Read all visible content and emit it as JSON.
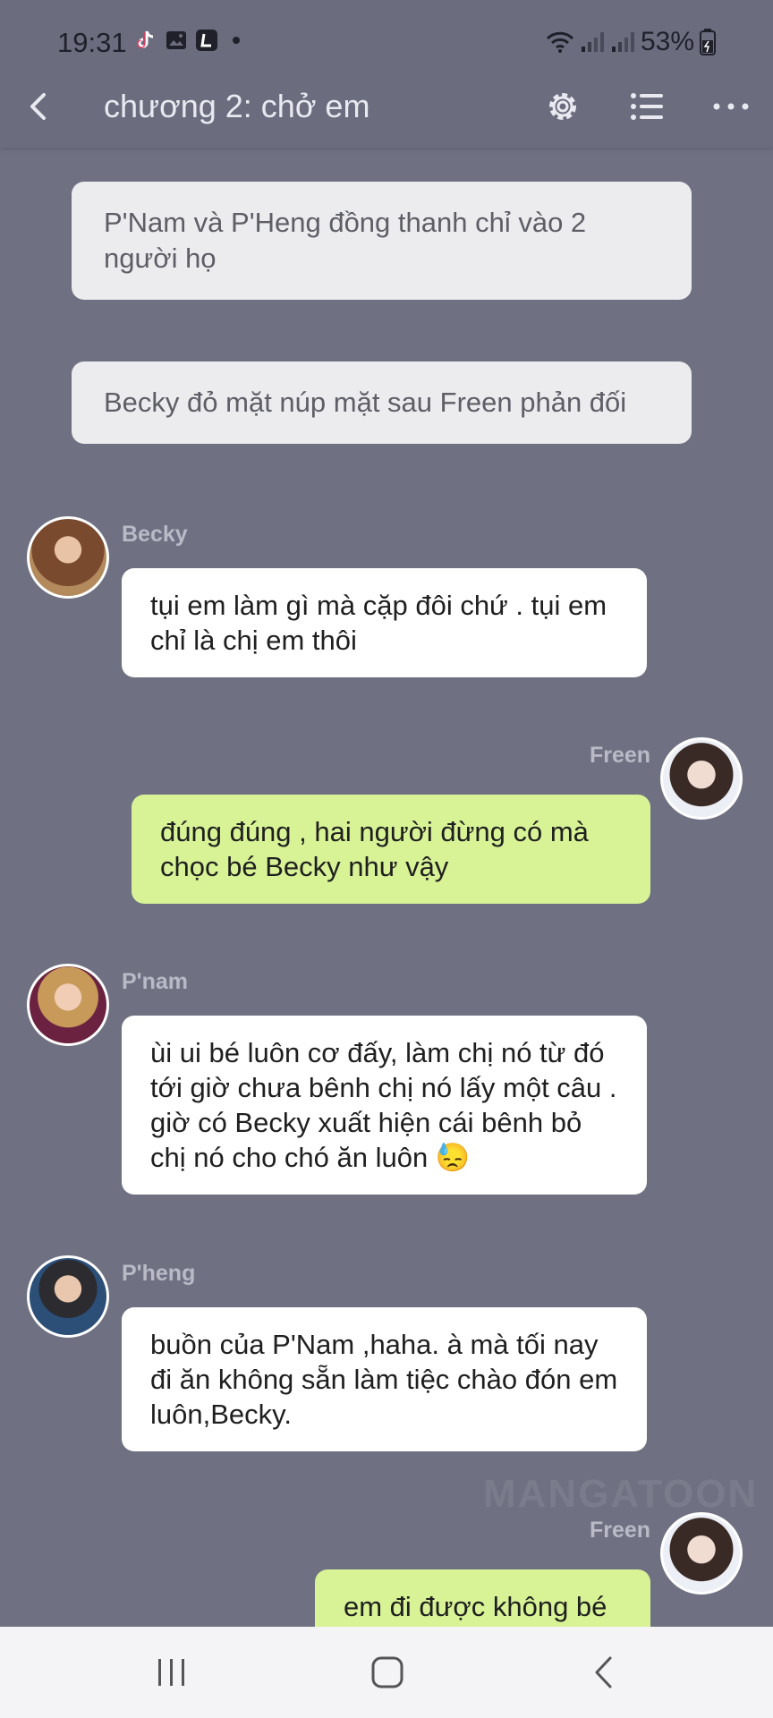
{
  "status_bar": {
    "time": "19:31",
    "battery": "53%"
  },
  "app_bar": {
    "title": "chương 2: chở em"
  },
  "messages": [
    {
      "type": "narration",
      "text": "P'Nam và P'Heng đồng thanh chỉ vào 2 người họ"
    },
    {
      "type": "narration",
      "text": "Becky đỏ mặt núp mặt sau Freen phản đối"
    },
    {
      "type": "left",
      "sender": "Becky",
      "text": "tụi em làm gì mà cặp đôi chứ . tụi em chỉ là chị em thôi"
    },
    {
      "type": "right",
      "sender": "Freen",
      "text": "đúng đúng , hai người đừng có mà chọc bé Becky như vậy"
    },
    {
      "type": "left",
      "sender": "P'nam",
      "text": "ùi ui bé luôn cơ đấy, làm chị nó từ đó tới giờ chưa bênh chị nó lấy một câu . giờ có Becky xuất hiện cái bênh bỏ chị nó cho chó ăn luôn 😓"
    },
    {
      "type": "left",
      "sender": "P'heng",
      "text": "buồn của P'Nam ,haha. à mà tối nay đi ăn không sẵn làm tiệc chào đón em luôn,Becky."
    },
    {
      "type": "right",
      "sender": "Freen",
      "text": "em đi được không bé"
    }
  ],
  "watermark": "MANGATOON",
  "colors": {
    "background": "#6f7183",
    "incoming_bubble": "#ffffff",
    "outgoing_bubble": "#d8f396",
    "narration_bubble": "#ececee"
  }
}
